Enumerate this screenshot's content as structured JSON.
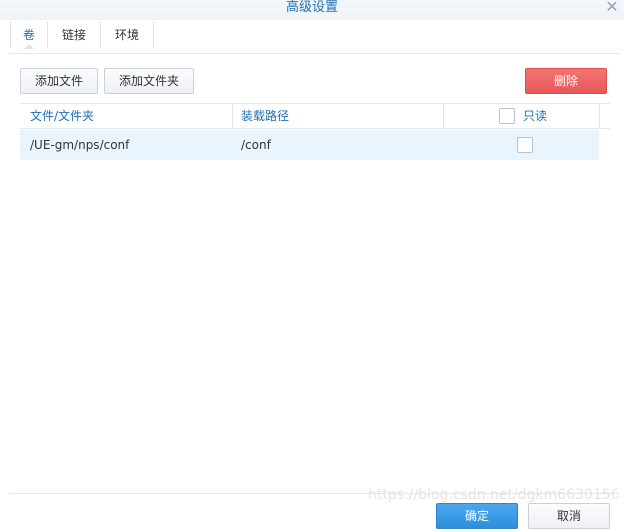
{
  "window": {
    "title": "高级设置",
    "close_icon": "close-icon"
  },
  "tabs": [
    {
      "label": "卷",
      "active": true
    },
    {
      "label": "链接",
      "active": false
    },
    {
      "label": "环境",
      "active": false
    }
  ],
  "toolbar": {
    "add_file_label": "添加文件",
    "add_folder_label": "添加文件夹",
    "delete_label": "删除"
  },
  "table": {
    "columns": [
      "文件/文件夹",
      "装载路径",
      "只读"
    ],
    "rows": [
      {
        "path": "/UE-gm/nps/conf",
        "mount": "/conf",
        "readonly": false
      }
    ]
  },
  "footer": {
    "ok_label": "确定",
    "cancel_label": "取消",
    "watermark": "https://blog.csdn.net/dgkm6630156"
  },
  "colors": {
    "accent": "#1f6fb5",
    "danger": "#e65858",
    "row_highlight": "#eaf4fc"
  }
}
